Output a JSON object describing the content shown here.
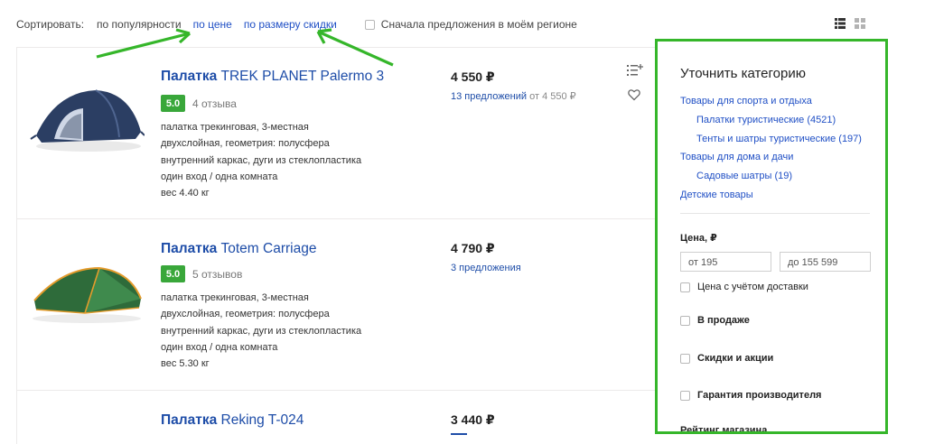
{
  "sort": {
    "label": "Сортировать:",
    "options": [
      "по популярности",
      "по цене",
      "по размеру скидки"
    ],
    "region_checkbox": "Сначала предложения в моём регионе"
  },
  "products": [
    {
      "title_bold": "Палатка",
      "title_rest": " TREK PLANET Palermo 3",
      "rating": "5.0",
      "reviews": "4 отзыва",
      "desc": [
        "палатка трекинговая, 3-местная",
        "двухслойная, геометрия: полусфера",
        "внутренний каркас, дуги из стеклопластика",
        "один вход / одна комната",
        "вес 4.40 кг"
      ],
      "price": "4 550 ₽",
      "offers": "13 предложений",
      "offers_from": " от 4 550 ₽"
    },
    {
      "title_bold": "Палатка",
      "title_rest": " Totem Carriage",
      "rating": "5.0",
      "reviews": "5 отзывов",
      "desc": [
        "палатка трекинговая, 3-местная",
        "двухслойная, геометрия: полусфера",
        "внутренний каркас, дуги из стеклопластика",
        "один вход / одна комната",
        "вес 5.30 кг"
      ],
      "price": "4 790 ₽",
      "offers": "3 предложения",
      "offers_from": ""
    },
    {
      "title_bold": "Палатка",
      "title_rest": " Reking T-024",
      "price": "3 440 ₽"
    }
  ],
  "panel": {
    "title": "Уточнить категорию",
    "categories": [
      "Товары для спорта и отдыха",
      "Палатки туристические (4521)",
      "Тенты и шатры туристические (197)",
      "Товары для дома и дачи",
      "Садовые шатры (19)",
      "Детские товары"
    ],
    "price_title": "Цена, ₽",
    "price_from": "от 195",
    "price_to": "до 155 599",
    "delivery": "Цена с учётом доставки",
    "on_sale": "В продаже",
    "discounts": "Скидки и акции",
    "warranty": "Гарантия производителя",
    "shop_rating": "Рейтинг магазина"
  },
  "colors": {
    "link": "#1f4fc5",
    "rating_badge": "#39a73a",
    "highlight_frame": "#35b62a"
  },
  "icons": [
    "list-view-icon",
    "grid-view-icon",
    "compare-icon",
    "heart-icon",
    "arrow-annotation"
  ]
}
